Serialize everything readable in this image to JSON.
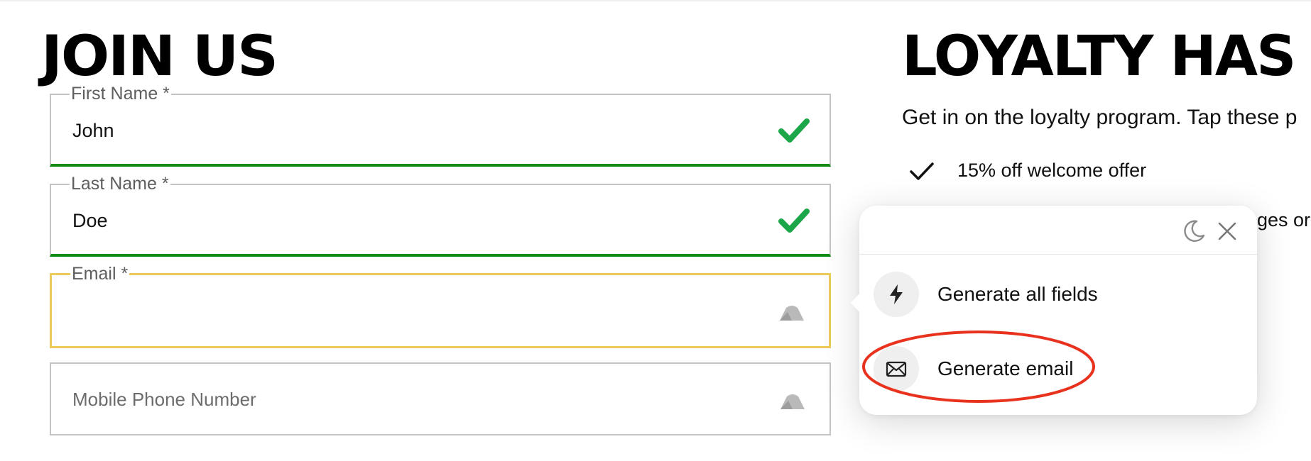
{
  "form": {
    "title": "JOIN US",
    "fields": [
      {
        "label": "First Name *",
        "value": "John",
        "state": "valid"
      },
      {
        "label": "Last Name *",
        "value": "Doe",
        "state": "valid"
      },
      {
        "label": "Email *",
        "value": "",
        "state": "focused"
      },
      {
        "label": "",
        "placeholder": "Mobile Phone Number",
        "value": "",
        "state": "empty"
      }
    ]
  },
  "loyalty": {
    "title": "LOYALTY HAS",
    "subtitle": "Get in on the loyalty program. Tap these p",
    "benefits": [
      "15% off welcome offer"
    ],
    "partial_text": "ges or"
  },
  "popup": {
    "header_icons": [
      "moon-icon",
      "close-icon"
    ],
    "items": [
      {
        "label": "Generate all fields",
        "icon": "lightning-icon"
      },
      {
        "label": "Generate email",
        "icon": "envelope-icon"
      }
    ]
  },
  "colors": {
    "valid_border": "#108a10",
    "focus_border": "#ebc95a",
    "check_green": "#1ca64a",
    "annotation": "#e8321e"
  }
}
